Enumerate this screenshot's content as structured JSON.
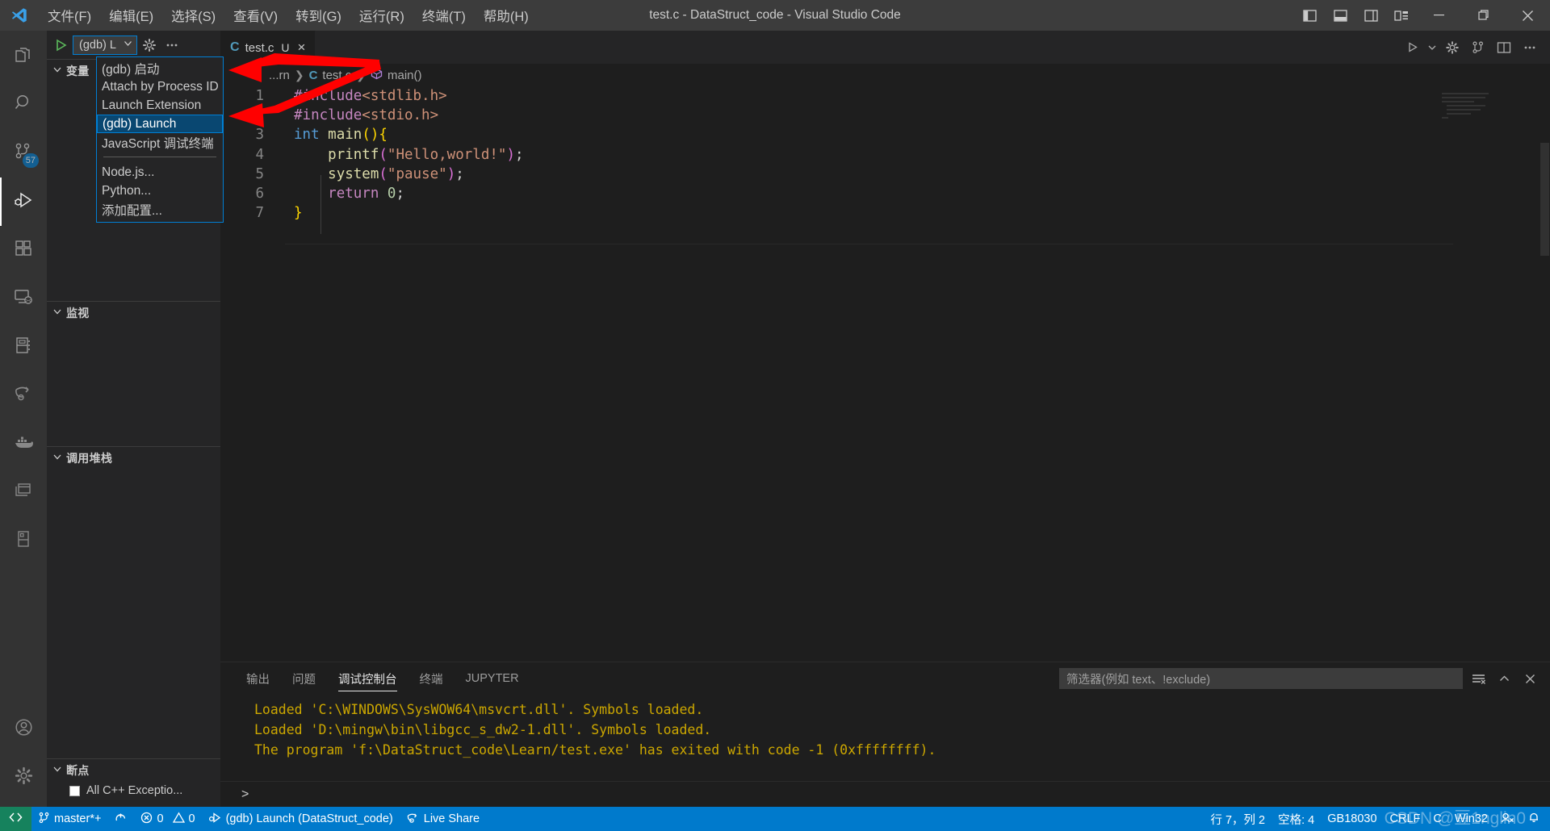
{
  "window": {
    "title": "test.c - DataStruct_code - Visual Studio Code",
    "menus": [
      "文件(F)",
      "编辑(E)",
      "选择(S)",
      "查看(V)",
      "转到(G)",
      "运行(R)",
      "终端(T)",
      "帮助(H)"
    ],
    "layout_icons": [
      "panel-left-icon",
      "panel-bottom-icon",
      "panel-right-icon",
      "customize-layout-icon"
    ],
    "controls": [
      "minimize-button",
      "maximize-button",
      "close-button"
    ]
  },
  "activitybar": {
    "items": [
      {
        "name": "explorer",
        "icon": "files-icon",
        "badge": ""
      },
      {
        "name": "search",
        "icon": "search-icon",
        "badge": ""
      },
      {
        "name": "source-control",
        "icon": "source-control-icon",
        "badge": "57"
      },
      {
        "name": "run-and-debug",
        "icon": "run-debug-icon",
        "badge": ""
      },
      {
        "name": "extensions",
        "icon": "extensions-icon",
        "badge": ""
      },
      {
        "name": "remote-explorer",
        "icon": "remote-icon",
        "badge": ""
      },
      {
        "name": "notebook",
        "icon": "notebook-icon",
        "badge": ""
      },
      {
        "name": "live-share",
        "icon": "live-share-icon",
        "badge": ""
      },
      {
        "name": "docker",
        "icon": "docker-icon",
        "badge": ""
      },
      {
        "name": "window-manager",
        "icon": "windows-icon",
        "badge": ""
      },
      {
        "name": "todo",
        "icon": "todo-icon",
        "badge": ""
      }
    ],
    "bottom": [
      {
        "name": "accounts",
        "icon": "account-icon"
      },
      {
        "name": "manage",
        "icon": "gear-icon"
      }
    ]
  },
  "sidebar": {
    "toolbar": {
      "start_debug": "start-debugging-icon",
      "config_label": "(gdb) L",
      "chevron": "chevron-down-icon",
      "settings": "gear-icon",
      "more": "ellipsis-icon"
    },
    "sections": [
      {
        "name": "variables",
        "label": "变量",
        "collapsed": false
      },
      {
        "name": "watch",
        "label": "监视",
        "collapsed": false
      },
      {
        "name": "callstack",
        "label": "调用堆栈",
        "collapsed": false
      },
      {
        "name": "breakpoints",
        "label": "断点",
        "collapsed": false
      }
    ],
    "breakpoint_item": "All C++ Exceptio..."
  },
  "dropdown": {
    "items": [
      {
        "label": "(gdb) 启动",
        "selected": false,
        "separator": false
      },
      {
        "label": "Attach by Process ID",
        "selected": false,
        "separator": false
      },
      {
        "label": "Launch Extension",
        "selected": false,
        "separator": false
      },
      {
        "label": "(gdb) Launch",
        "selected": true,
        "separator": false
      },
      {
        "label": "JavaScript 调试终端",
        "selected": false,
        "separator": false
      },
      {
        "label": "",
        "selected": false,
        "separator": true
      },
      {
        "label": "Node.js...",
        "selected": false,
        "separator": false
      },
      {
        "label": "Python...",
        "selected": false,
        "separator": false
      },
      {
        "label": "添加配置...",
        "selected": false,
        "separator": false
      }
    ]
  },
  "editor": {
    "tab": {
      "filename": "test.c",
      "icon": "c-file-icon",
      "dirty_marker": "U",
      "close": "×"
    },
    "toolbar_icons": [
      "run-icon",
      "run-chevron-icon",
      "gear-icon",
      "source-control-icon",
      "split-editor-icon",
      "more-actions-icon"
    ],
    "breadcrumb": [
      {
        "label": "...rn",
        "icon": ""
      },
      {
        "label": "test.c",
        "icon": "c-file-icon"
      },
      {
        "label": "main()",
        "icon": "symbol-method-icon"
      }
    ],
    "lines": [
      {
        "n": "1",
        "tokens": [
          {
            "t": "#include",
            "c": "k-pre"
          },
          {
            "t": "<stdlib.h>",
            "c": "k-hdr"
          }
        ]
      },
      {
        "n": "2",
        "tokens": [
          {
            "t": "#include",
            "c": "k-pre"
          },
          {
            "t": "<stdio.h>",
            "c": "k-hdr"
          }
        ]
      },
      {
        "n": "3",
        "tokens": [
          {
            "t": "int ",
            "c": "k-type"
          },
          {
            "t": "main",
            "c": "k-fn"
          },
          {
            "t": "()",
            "c": "k-paren"
          },
          {
            "t": "{",
            "c": "k-paren"
          }
        ]
      },
      {
        "n": "4",
        "tokens": [
          {
            "t": "    ",
            "c": "k-txt"
          },
          {
            "t": "printf",
            "c": "k-fn"
          },
          {
            "t": "(",
            "c": "k-paren2"
          },
          {
            "t": "\"Hello,world!\"",
            "c": "k-str"
          },
          {
            "t": ")",
            "c": "k-paren2"
          },
          {
            "t": ";",
            "c": "k-txt"
          }
        ]
      },
      {
        "n": "5",
        "tokens": [
          {
            "t": "    ",
            "c": "k-txt"
          },
          {
            "t": "system",
            "c": "k-fn"
          },
          {
            "t": "(",
            "c": "k-paren2"
          },
          {
            "t": "\"pause\"",
            "c": "k-str"
          },
          {
            "t": ")",
            "c": "k-paren2"
          },
          {
            "t": ";",
            "c": "k-txt"
          }
        ]
      },
      {
        "n": "6",
        "tokens": [
          {
            "t": "    ",
            "c": "k-txt"
          },
          {
            "t": "return ",
            "c": "k-kw"
          },
          {
            "t": "0",
            "c": "k-num"
          },
          {
            "t": ";",
            "c": "k-txt"
          }
        ]
      },
      {
        "n": "7",
        "tokens": [
          {
            "t": "}",
            "c": "k-paren"
          }
        ]
      }
    ]
  },
  "panel": {
    "tabs": [
      {
        "label": "输出",
        "active": false
      },
      {
        "label": "问题",
        "active": false
      },
      {
        "label": "调试控制台",
        "active": true
      },
      {
        "label": "终端",
        "active": false
      },
      {
        "label": "JUPYTER",
        "active": false
      }
    ],
    "filter_placeholder": "筛选器(例如 text、!exclude)",
    "filter_value": "",
    "right_icons": [
      "clear-console-icon",
      "chevron-up-icon",
      "close-panel-icon"
    ],
    "console_lines": [
      "Loaded 'C:\\WINDOWS\\SysWOW64\\msvcrt.dll'. Symbols loaded.",
      "Loaded 'D:\\mingw\\bin\\libgcc_s_dw2-1.dll'. Symbols loaded.",
      "The program 'f:\\DataStruct_code\\Learn/test.exe' has exited with code -1 (0xffffffff)."
    ],
    "console_prompt": ">"
  },
  "statusbar": {
    "remote_icon": "remote-indicator-icon",
    "left": [
      {
        "icon": "source-control-branch-icon",
        "label": "master*+"
      },
      {
        "icon": "sync-icon",
        "label": ""
      },
      {
        "icon": "error-icon",
        "label": "0"
      },
      {
        "icon": "warning-icon",
        "label": "0"
      },
      {
        "icon": "debug-config-icon",
        "label": "(gdb) Launch (DataStruct_code)"
      },
      {
        "icon": "live-share-icon",
        "label": "Live Share"
      }
    ],
    "right": [
      {
        "icon": "",
        "label": "行 7，列 2"
      },
      {
        "icon": "",
        "label": "空格: 4"
      },
      {
        "icon": "",
        "label": "GB18030"
      },
      {
        "icon": "",
        "label": "CRLF"
      },
      {
        "icon": "",
        "label": "C"
      },
      {
        "icon": "",
        "label": "Win32"
      },
      {
        "icon": "feedback-icon",
        "label": ""
      },
      {
        "icon": "bell-icon",
        "label": ""
      }
    ]
  },
  "watermark": "CSDN @豆1nglin0",
  "colors": {
    "accent": "#007acc",
    "remote": "#16825d",
    "titlebar": "#3c3c3c",
    "sidebar": "#252526",
    "editor": "#1e1e1e",
    "selection": "#094771",
    "border": "#007fd4",
    "arrow": "#ff0000",
    "console_text": "#cca700"
  }
}
